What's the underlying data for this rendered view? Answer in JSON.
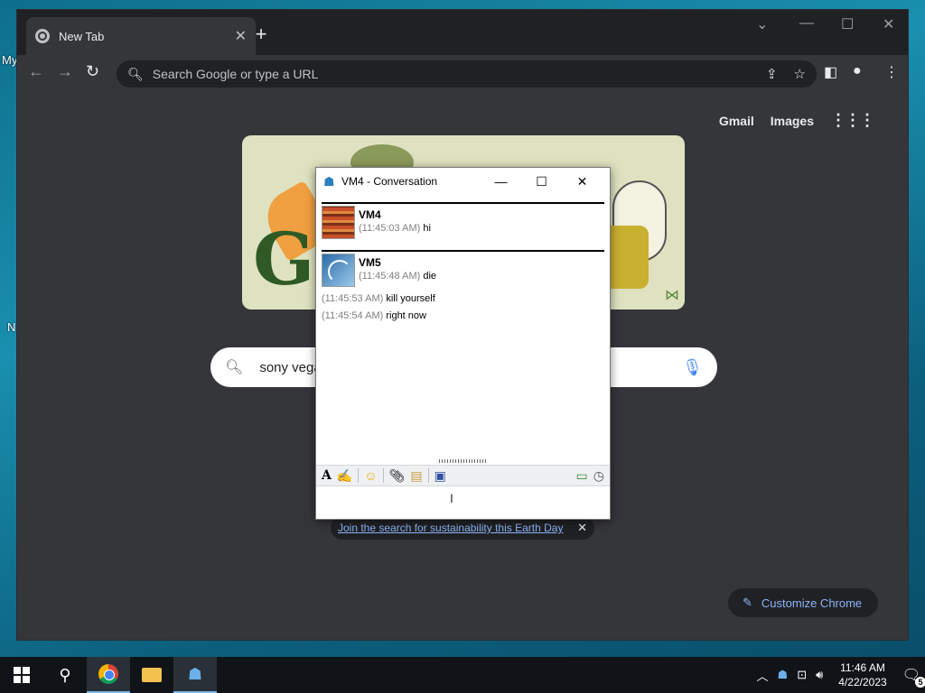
{
  "desktop": {
    "fragment_my": "My",
    "fragment_n": "N"
  },
  "chrome": {
    "tab_title": "New Tab",
    "omnibox_placeholder": "Search Google or type a URL",
    "links": {
      "gmail": "Gmail",
      "images": "Images"
    },
    "search_query": "sony vega",
    "promo_link": "Join the search for sustainability this Earth Day",
    "customize_label": "Customize Chrome"
  },
  "conversation": {
    "title": "VM4 - Conversation",
    "messages": [
      {
        "sender": "VM4",
        "lines": [
          {
            "time": "(11:45:03 AM)",
            "text": "hi"
          }
        ]
      },
      {
        "sender": "VM5",
        "lines": [
          {
            "time": "(11:45:48 AM)",
            "text": "die"
          },
          {
            "time": "(11:45:53 AM)",
            "text": "kill yourself"
          },
          {
            "time": "(11:45:54 AM)",
            "text": "right now"
          }
        ]
      }
    ]
  },
  "taskbar": {
    "time": "11:46 AM",
    "date": "4/22/2023",
    "notification_count": "5"
  },
  "colors": {
    "chrome_bg": "#35363a",
    "link": "#8ab4f8",
    "desktop": "#0e6f8c"
  }
}
